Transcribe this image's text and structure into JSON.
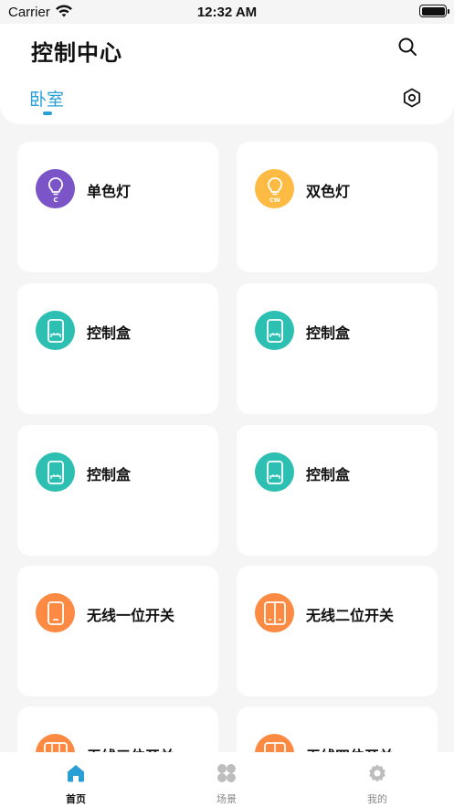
{
  "status_bar": {
    "carrier": "Carrier",
    "time": "12:32 AM"
  },
  "header": {
    "title": "控制中心",
    "room": "卧室"
  },
  "devices": [
    {
      "name": "单色灯",
      "icon": "bulb-icon",
      "color": "#7b55c7",
      "badge": "C"
    },
    {
      "name": "双色灯",
      "icon": "bulb-icon",
      "color": "#fdbb44",
      "badge": "CW"
    },
    {
      "name": "控制盒",
      "icon": "control-box-icon",
      "color": "#2ebfb3"
    },
    {
      "name": "控制盒",
      "icon": "control-box-icon",
      "color": "#2ebfb3"
    },
    {
      "name": "控制盒",
      "icon": "control-box-icon",
      "color": "#2ebfb3"
    },
    {
      "name": "控制盒",
      "icon": "control-box-icon",
      "color": "#2ebfb3"
    },
    {
      "name": "无线一位开关",
      "icon": "switch-1-icon",
      "color": "#fc8a42"
    },
    {
      "name": "无线二位开关",
      "icon": "switch-2-icon",
      "color": "#fc8a42"
    },
    {
      "name": "无线三位开关",
      "icon": "switch-3-icon",
      "color": "#fc8a42"
    },
    {
      "name": "无线四位开关",
      "icon": "switch-4-icon",
      "color": "#fc8a42"
    }
  ],
  "tabbar": {
    "home": "首页",
    "scene": "场景",
    "mine": "我的"
  },
  "colors": {
    "accent": "#2a9fd6"
  }
}
